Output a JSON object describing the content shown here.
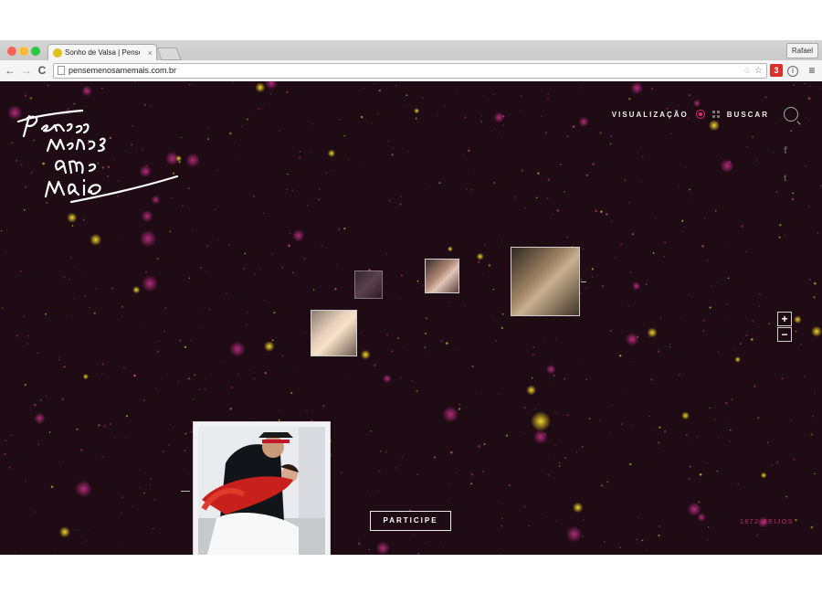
{
  "browser": {
    "tab_title": "Sonho de Valsa | Pense Me",
    "tab_close": "×",
    "user": "Rafael",
    "url": "pensemenosamemais.com.br",
    "nav": {
      "back": "←",
      "forward": "→",
      "reload": "C"
    },
    "ext_badge": "3"
  },
  "site": {
    "logo_lines": [
      "Pense",
      "menos",
      "ame",
      "mais"
    ],
    "nav": {
      "visualizacao": "VISUALIZAÇÃO",
      "buscar": "BUSCAR"
    },
    "social": {
      "facebook": "f",
      "twitter": "t"
    },
    "zoom": {
      "in": "+",
      "out": "−"
    },
    "cta": "PARTICIPE",
    "count": "1872 BEIJOS",
    "colors": {
      "background": "#1e0b14",
      "accent": "#e8287a",
      "star_yellow": "#e6c81e",
      "star_pink": "#b82a7a"
    }
  }
}
